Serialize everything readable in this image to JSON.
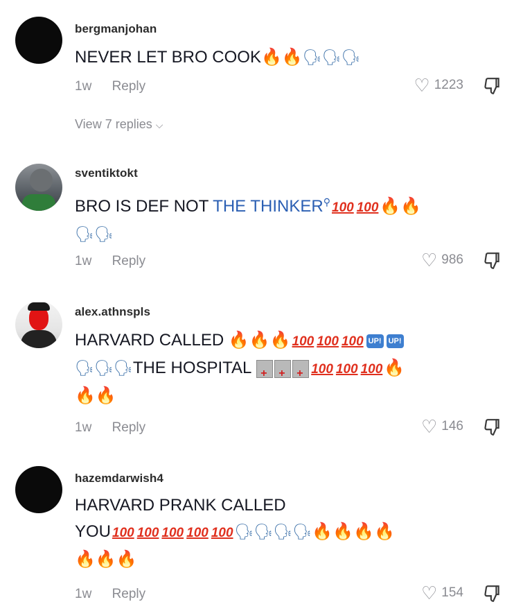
{
  "comments": [
    {
      "username": "bergmanjohan",
      "text_prefix": "NEVER LET BRO COOK",
      "time": "1w",
      "reply_label": "Reply",
      "likes": "1223",
      "view_replies": "View 7 replies"
    },
    {
      "username": "sventiktokt",
      "text_prefix": "BRO IS DEF NOT ",
      "text_link": "THE THINKER",
      "time": "1w",
      "reply_label": "Reply",
      "likes": "986"
    },
    {
      "username": "alex.athnspls",
      "text_prefix": "HARVARD CALLED",
      "text_mid": "THE HOSPITAL",
      "up_label": "UP!",
      "time": "1w",
      "reply_label": "Reply",
      "likes": "146"
    },
    {
      "username": "hazemdarwish4",
      "text_line1": "HARVARD PRANK CALLED",
      "text_line2": "YOU",
      "time": "1w",
      "reply_label": "Reply",
      "likes": "154"
    }
  ],
  "emoji": {
    "fire": "🔥",
    "hundred": "100",
    "speaking_head": "🗣",
    "search_glyph": "⚲"
  },
  "icons": {
    "heart": "heart-outline-icon",
    "dislike": "thumbs-down-icon",
    "chevron": "chevron-down-icon"
  },
  "colors": {
    "username": "#2b2b2b",
    "meta": "#8a8b91",
    "link": "#2b5fb3",
    "hundred": "#e0301e"
  }
}
